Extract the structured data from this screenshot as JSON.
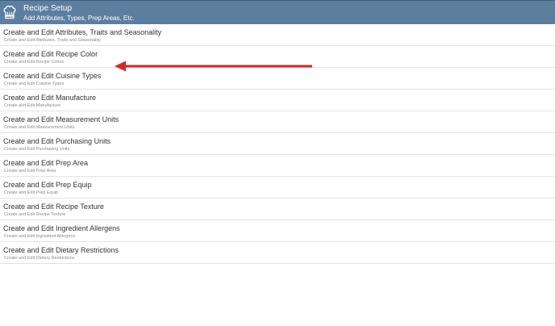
{
  "header": {
    "title": "Recipe Setup",
    "subtitle": "Add Attributes, Types, Prep Areas, Etc.",
    "icon": "chef-hat-icon",
    "bg_color": "#5c7fa0"
  },
  "items": [
    {
      "title": "Create and Edit Attributes, Traits and Seasonality",
      "subtitle": "Create and Edit Attributes, Traits and Seasonality"
    },
    {
      "title": "Create and Edit Recipe Color",
      "subtitle": "Create and Edit Recipe Colors"
    },
    {
      "title": "Create and Edit Cuisine Types",
      "subtitle": "Create and Edit Cuisine Types"
    },
    {
      "title": "Create and Edit Manufacture",
      "subtitle": "Create and Edit Manufacture"
    },
    {
      "title": "Create and Edit Measurement Units",
      "subtitle": "Create and Edit Measurement Units"
    },
    {
      "title": "Create and Edit Purchasing Units",
      "subtitle": "Create and Edit Purchasing Units"
    },
    {
      "title": "Create and Edit Prep Area",
      "subtitle": "Create and Edit Prep Area"
    },
    {
      "title": "Create and Edit Prep Equip",
      "subtitle": "Create and Edit Prep Equip"
    },
    {
      "title": "Create and Edit Recipe Texture",
      "subtitle": "Create and Edit Recipe Texture"
    },
    {
      "title": "Create and Edit Ingredient Allergens",
      "subtitle": "Create and Edit Ingredient Allergens"
    },
    {
      "title": "Create and Edit Dietary Restrictions",
      "subtitle": "Create and Edit Dietary Restrictions"
    }
  ],
  "annotation": {
    "icon": "red-arrow-icon",
    "color": "#d42a2a"
  }
}
